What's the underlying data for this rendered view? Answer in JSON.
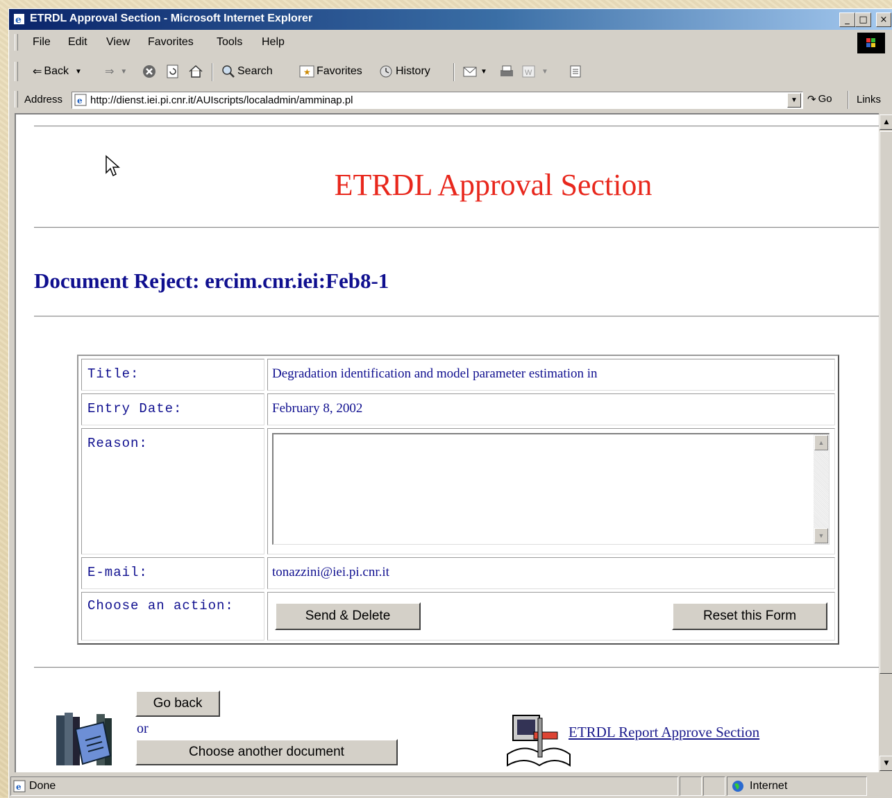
{
  "window": {
    "title": "ETRDL Approval Section - Microsoft Internet Explorer",
    "minimize": "_",
    "maximize": "□",
    "close": "×"
  },
  "menu": [
    "File",
    "Edit",
    "View",
    "Favorites",
    "Tools",
    "Help"
  ],
  "toolbar": {
    "back": "Back",
    "search": "Search",
    "favorites": "Favorites",
    "history": "History"
  },
  "address": {
    "label": "Address",
    "url": "http://dienst.iei.pi.cnr.it/AUIscripts/localadmin/amminap.pl",
    "go": "Go",
    "links": "Links"
  },
  "page": {
    "heading": "ETRDL Approval Section",
    "subheading": "Document Reject: ercim.cnr.iei:Feb8-1",
    "form": {
      "title_label": "Title:",
      "title_value": "Degradation identification and model parameter estimation in",
      "entry_date_label": "Entry Date:",
      "entry_date_value": "February 8, 2002",
      "reason_label": "Reason:",
      "reason_value": "",
      "email_label": "E-mail:",
      "email_value": "tonazzini@iei.pi.cnr.it",
      "action_label": "Choose an action:",
      "send_delete": "Send & Delete",
      "reset": "Reset this Form"
    },
    "go_back": "Go back",
    "or": "or",
    "choose_another": "Choose another document",
    "report_link": "ETRDL Report Approve Section"
  },
  "status": {
    "text": "Done",
    "zone": "Internet"
  }
}
